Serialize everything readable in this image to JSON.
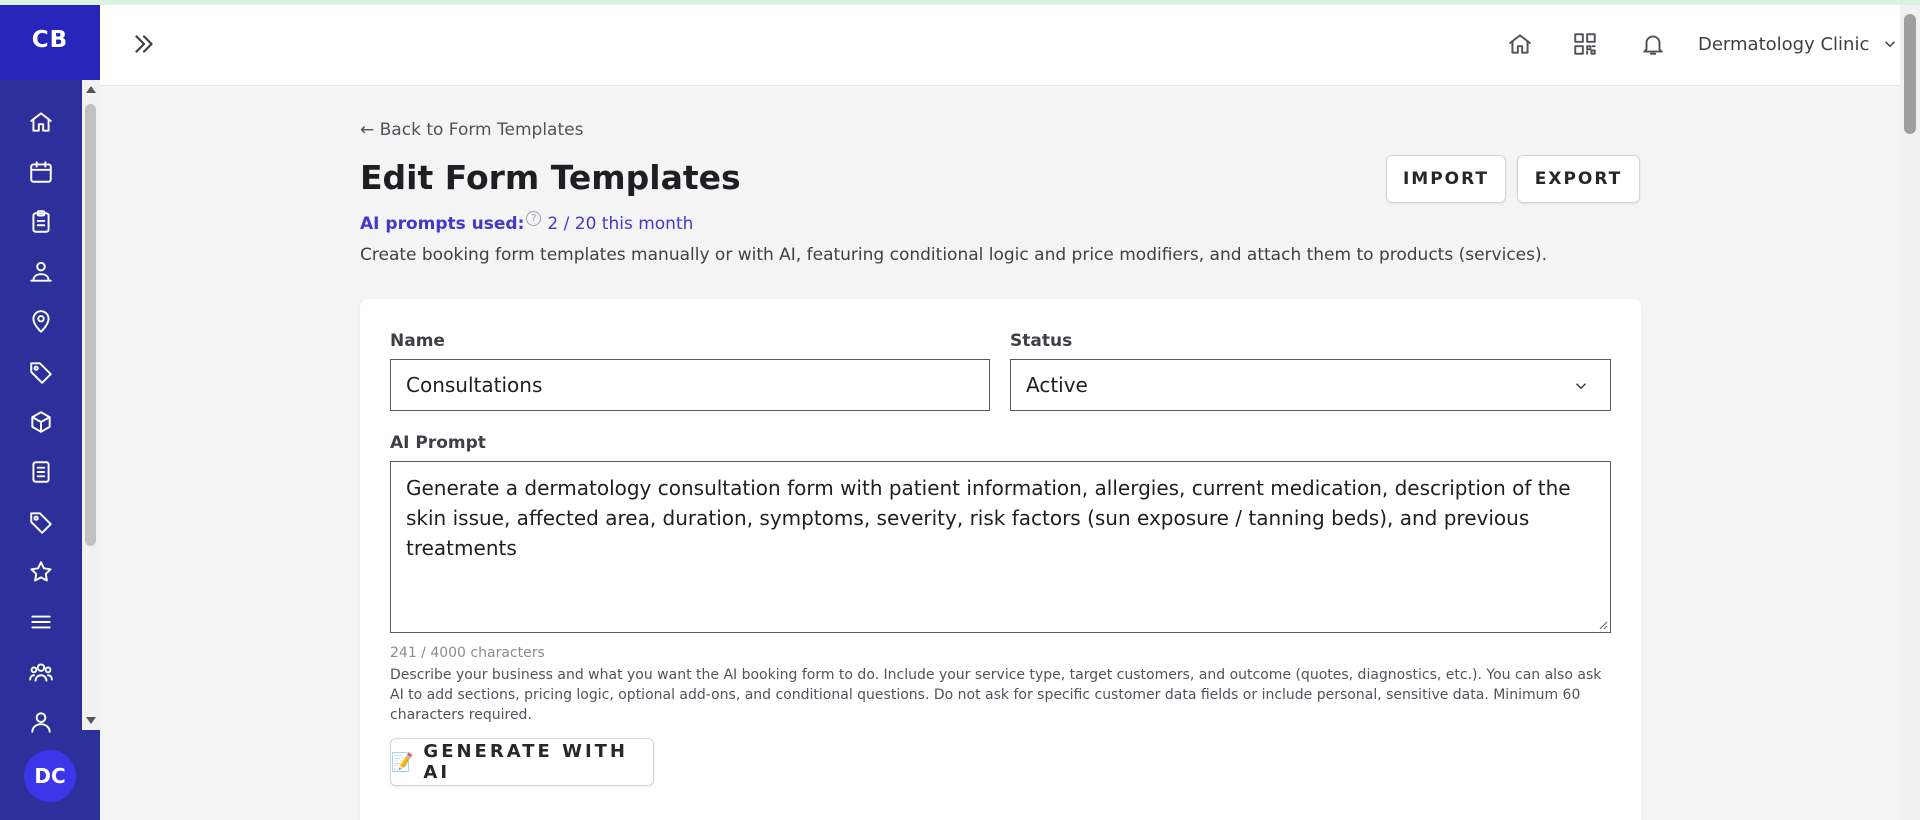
{
  "brand": "CB",
  "user": {
    "initials": "DC"
  },
  "nav": [
    "home-icon",
    "calendar-icon",
    "clipboard-icon",
    "users-group-icon",
    "location-icon",
    "tag-icon",
    "box-icon",
    "list-document-icon",
    "price-tag-icon",
    "star-icon",
    "menu-icon",
    "team-icon",
    "user-icon"
  ],
  "topbar": {
    "clinic_name": "Dermatology Clinic"
  },
  "page": {
    "back_link": "← Back to Form Templates",
    "title": "Edit Form Templates",
    "import_label": "IMPORT",
    "export_label": "EXPORT",
    "ai_prompts_label": "AI prompts used:",
    "ai_prompts_value": "2 / 20 this month",
    "description": "Create booking form templates manually or with AI, featuring conditional logic and price modifiers, and attach them to products (services)."
  },
  "form": {
    "name_label": "Name",
    "name_value": "Consultations",
    "status_label": "Status",
    "status_value": "Active",
    "prompt_label": "AI Prompt",
    "prompt_value": "Generate a dermatology consultation form with patient information, allergies, current medication, description of the skin issue, affected area, duration, symptoms, severity, risk factors (sun exposure / tanning beds), and previous treatments",
    "char_count": "241 / 4000 characters",
    "help_text": "Describe your business and what you want the AI booking form to do. Include your service type, target customers, and outcome (quotes, diagnostics, etc.). You can also ask AI to add sections, pricing logic, optional add-ons, and conditional questions. Do not ask for specific customer data fields or include personal, sensitive data. Minimum 60 characters required.",
    "generate_label": "GENERATE WITH AI",
    "generate_icon": "📝"
  }
}
